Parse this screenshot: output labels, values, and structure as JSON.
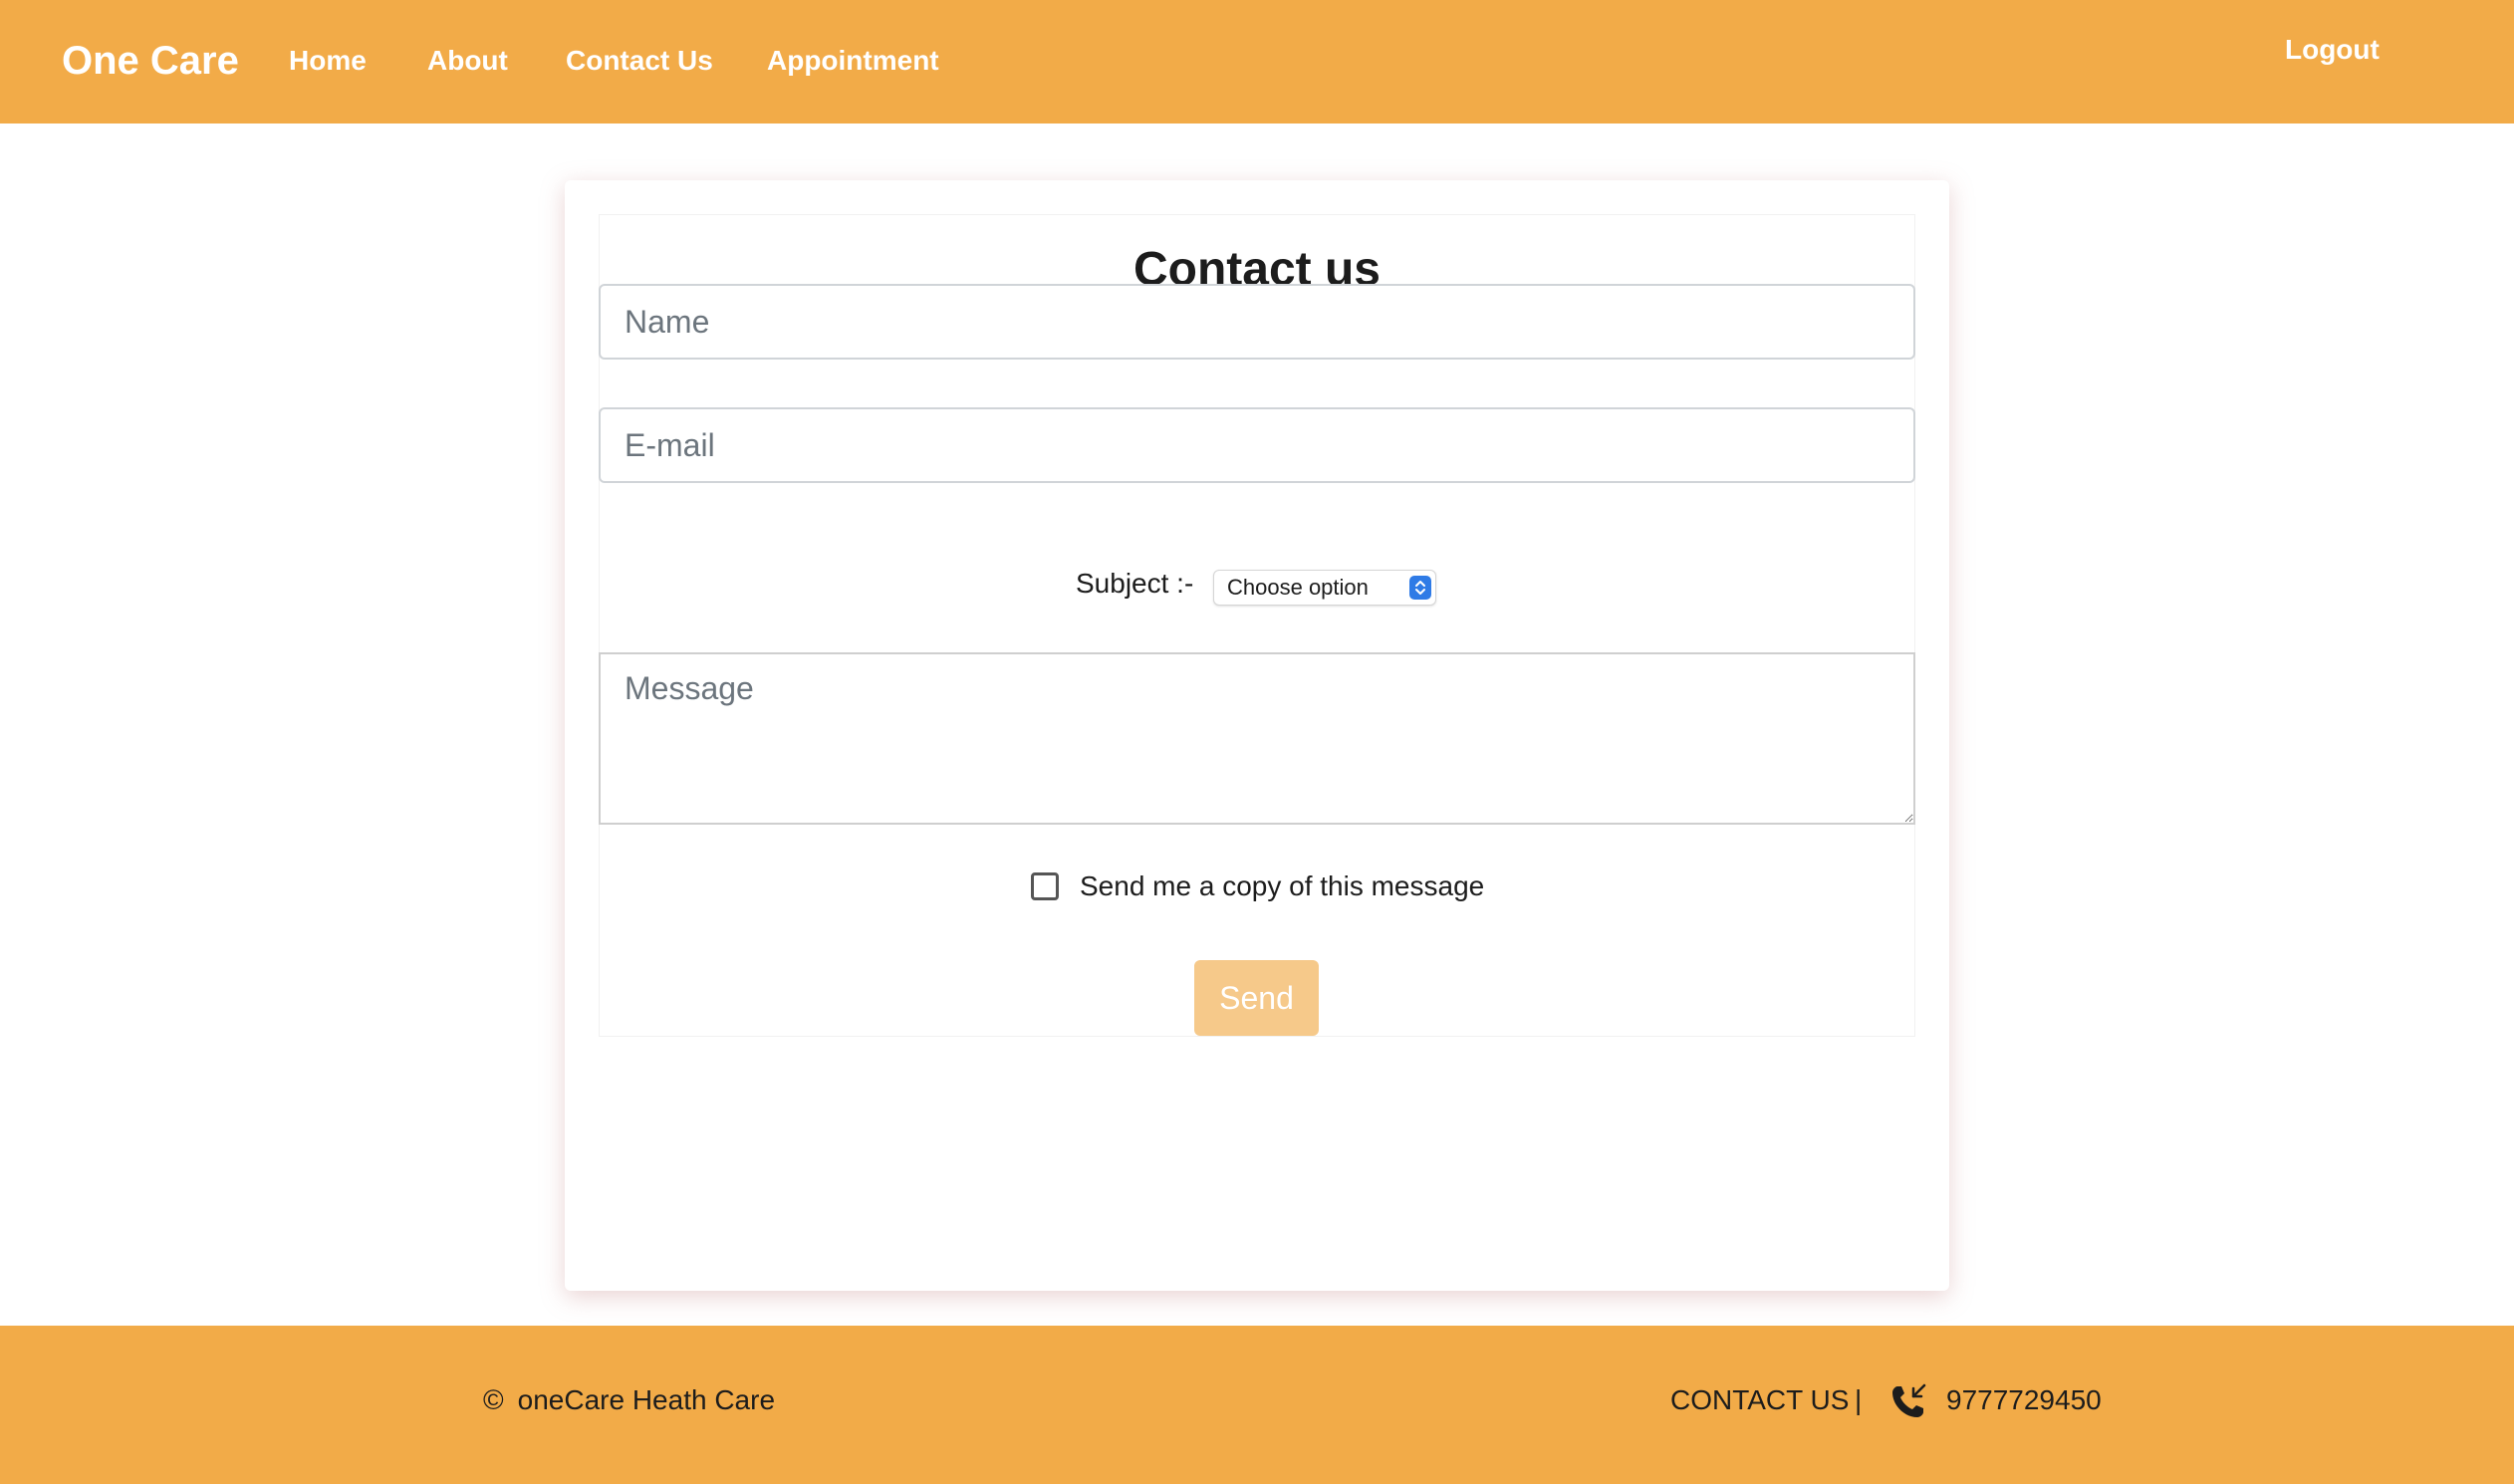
{
  "navbar": {
    "brand": "One Care",
    "links": [
      "Home",
      "About",
      "Contact Us",
      "Appointment"
    ],
    "logout": "Logout"
  },
  "form": {
    "title": "Contact us",
    "name_placeholder": "Name",
    "email_placeholder": "E-mail",
    "subject_label": "Subject :-",
    "subject_selected": "Choose option",
    "message_placeholder": "Message",
    "copy_label": "Send me a copy of this message",
    "copy_checked": false,
    "send_label": "Send"
  },
  "footer": {
    "copyright_symbol": "©",
    "copyright_text": "oneCare Heath Care",
    "contact_label": "CONTACT US",
    "separator": "|",
    "phone": "9777729450"
  },
  "colors": {
    "brand": "#f2ab48",
    "send_button": "#f6c98a",
    "select_accent": "#2f7be6"
  }
}
